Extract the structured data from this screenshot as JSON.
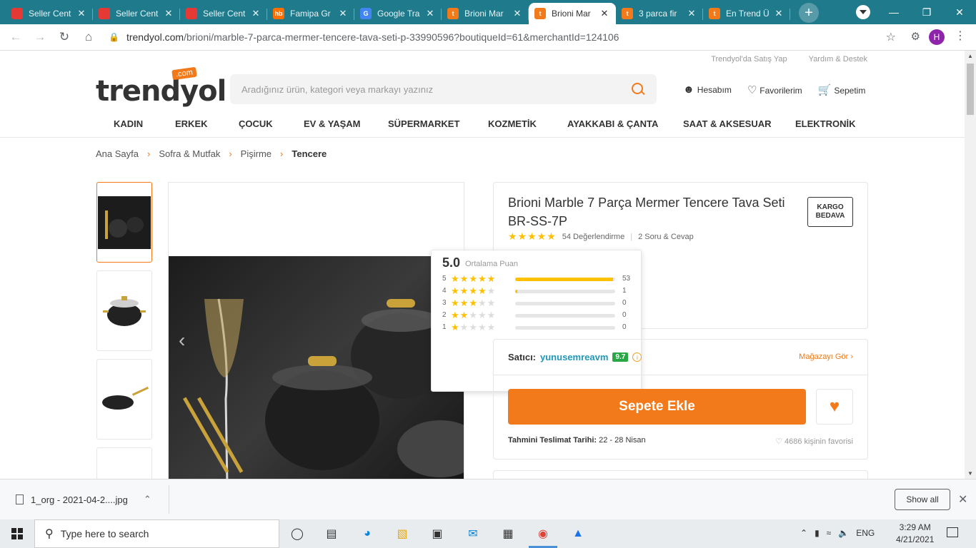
{
  "browser": {
    "tabs": [
      {
        "title": "Seller Cent",
        "favicon_color": "#e53935",
        "favicon_label": "",
        "active": false
      },
      {
        "title": "Seller Cent",
        "favicon_color": "#e53935",
        "favicon_label": "",
        "active": false
      },
      {
        "title": "Seller Cent",
        "favicon_color": "#e53935",
        "favicon_label": "",
        "active": false
      },
      {
        "title": "Famipa Gr",
        "favicon_color": "#ff6f00",
        "favicon_label": "hb",
        "active": false
      },
      {
        "title": "Google Tra",
        "favicon_color": "#4285f4",
        "favicon_label": "G",
        "active": false
      },
      {
        "title": "Brioni Mar",
        "favicon_color": "#f27a1a",
        "favicon_label": "t",
        "active": false
      },
      {
        "title": "Brioni Mar",
        "favicon_color": "#f27a1a",
        "favicon_label": "t",
        "active": true
      },
      {
        "title": "3 parca fir",
        "favicon_color": "#f27a1a",
        "favicon_label": "t",
        "active": false
      },
      {
        "title": "En Trend Ü",
        "favicon_color": "#f27a1a",
        "favicon_label": "t",
        "active": false
      }
    ],
    "url_host": "trendyol.com",
    "url_path": "/brioni/marble-7-parca-mermer-tencere-tava-seti-p-33990596?boutiqueId=61&merchantId=124106",
    "profile_initial": "H",
    "accent_color": "#1f7a8c"
  },
  "site": {
    "top_links": [
      "Trendyol'da Satış Yap",
      "Yardım & Destek"
    ],
    "logo_text": "trendyol",
    "logo_badge": ".com",
    "search_placeholder": "Aradığınız ürün, kategori veya markayı yazınız",
    "user_actions": [
      {
        "label": "Hesabım",
        "icon": "person-icon"
      },
      {
        "label": "Favorilerim",
        "icon": "heart-icon"
      },
      {
        "label": "Sepetim",
        "icon": "cart-icon"
      }
    ],
    "categories": [
      "KADIN",
      "ERKEK",
      "ÇOCUK",
      "EV & YAŞAM",
      "SÜPERMARKET",
      "KOZMETİK",
      "AYAKKABI & ÇANTA",
      "SAAT & AKSESUAR",
      "ELEKTRONİK"
    ],
    "brand_color": "#f27a1a"
  },
  "breadcrumb": [
    "Ana Sayfa",
    "Sofra & Mutfak",
    "Pişirme",
    "Tencere"
  ],
  "product": {
    "brand": "Brioni",
    "title_rest": "Marble 7 Parça Mermer Tencere Tava Seti BR-SS-7P",
    "cargo_badge": "KARGO BEDAVA",
    "review_count": "54 Değerlendirme",
    "qa_count": "2 Soru & Cevap",
    "star_rating": 5
  },
  "rating_popup": {
    "average": "5.0",
    "average_label": "Ortalama Puan",
    "rows": [
      {
        "stars": "5",
        "filled": 5,
        "count": "53",
        "fraction": 0.98
      },
      {
        "stars": "4",
        "filled": 4,
        "count": "1",
        "fraction": 0.02
      },
      {
        "stars": "3",
        "filled": 3,
        "count": "0",
        "fraction": 0
      },
      {
        "stars": "2",
        "filled": 2,
        "count": "0",
        "fraction": 0
      },
      {
        "stars": "1",
        "filled": 1,
        "count": "0",
        "fraction": 0
      }
    ]
  },
  "seller": {
    "label": "Satıcı:",
    "name": "yunusemreavm",
    "score": "9.7",
    "store_link": "Mağazayı Gör",
    "add_to_cart": "Sepete Ekle",
    "delivery_label": "Tahmini Teslimat Tarihi:",
    "delivery_dates": "22 - 28 Nisan",
    "fav_count": "4686 kişinin favorisi"
  },
  "downloads": {
    "file_name": "1_org - 2021-04-2....jpg",
    "show_all": "Show all"
  },
  "taskbar": {
    "search_placeholder": "Type here to search",
    "language": "ENG",
    "time": "3:29 AM",
    "date": "4/21/2021"
  }
}
